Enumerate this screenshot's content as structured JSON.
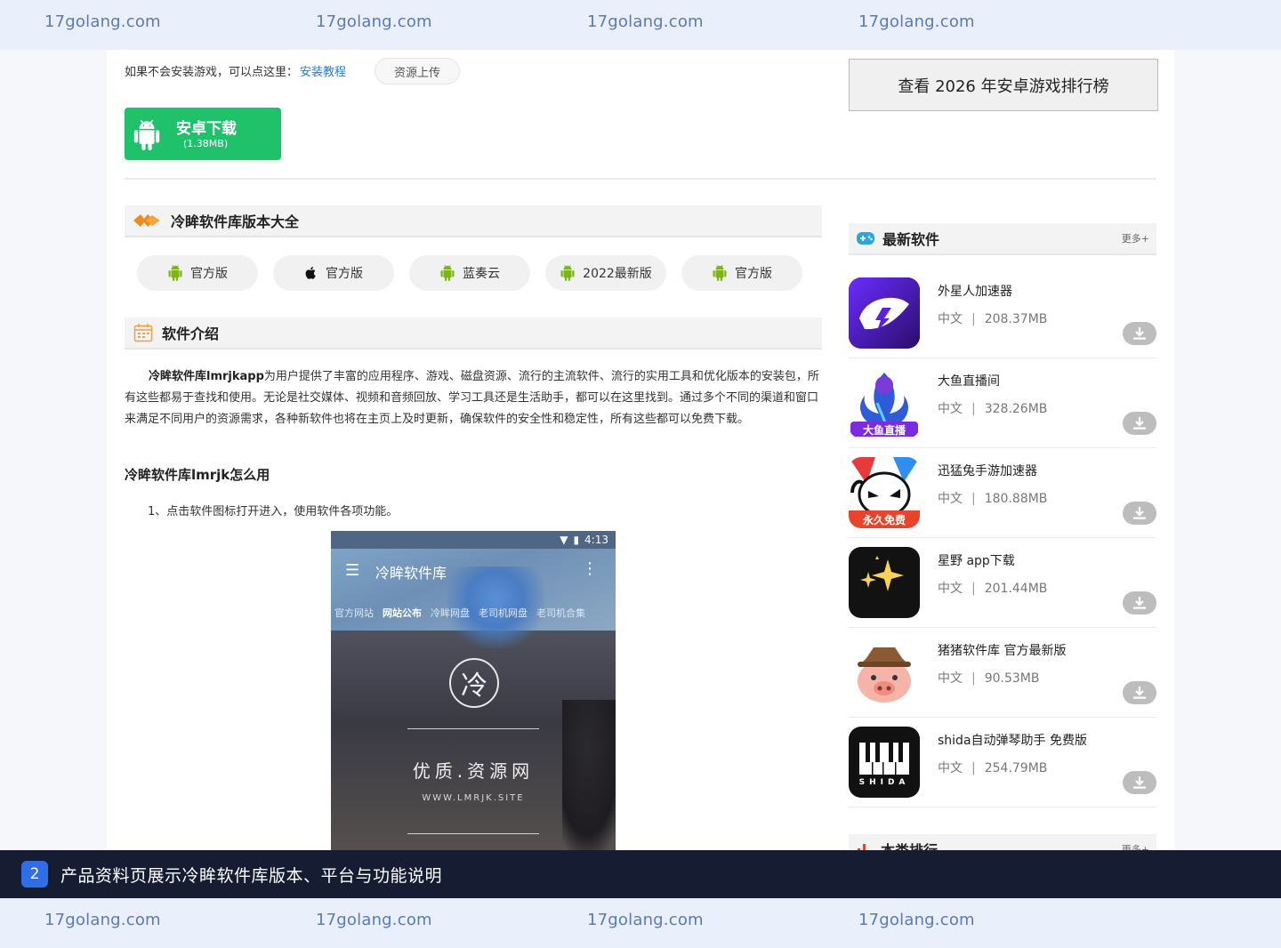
{
  "watermarks": [
    "17golang.com",
    "17golang.com",
    "17golang.com",
    "17golang.com"
  ],
  "install": {
    "hint": "如果不会安装游戏，可以点这里：",
    "link": "安装教程",
    "upload": "资源上传"
  },
  "download": {
    "label": "安卓下载",
    "size": "(1.38MB)"
  },
  "ranking_button": "查看 2026 年安卓游戏排行榜",
  "versions": {
    "title": "冷眸软件库版本大全",
    "items": [
      {
        "label": "官方版",
        "icon": "android-icon"
      },
      {
        "label": "官方版",
        "icon": "apple-icon"
      },
      {
        "label": "蓝奏云",
        "icon": "android-icon"
      },
      {
        "label": "2022最新版",
        "icon": "android-icon"
      },
      {
        "label": "官方版",
        "icon": "android-icon"
      }
    ]
  },
  "intro": {
    "title": "软件介绍",
    "bold": "冷眸软件库lmrjkapp",
    "body": "为用户提供了丰富的应用程序、游戏、磁盘资源、流行的主流软件、流行的实用工具和优化版本的安装包，所有这些都易于查找和使用。无论是社交媒体、视频和音频回放、学习工具还是生活助手，都可以在这里找到。通过多个不同的渠道和窗口来满足不同用户的资源需求，各种新软件也将在主页上及时更新，确保软件的安全性和稳定性，所有这些都可以免费下载。",
    "howto_title": "冷眸软件库lmrjk怎么用",
    "step1": "1、点击软件图标打开进入，使用软件各项功能。"
  },
  "screenshot": {
    "time": "4:13",
    "app_name": "冷眸软件库",
    "tabs": [
      "官方网站",
      "网站公布",
      "冷眸网盘",
      "老司机网盘",
      "老司机合集"
    ],
    "seal_char": "冷",
    "slogan": "优质.资源网",
    "site": "WWW.LMRJK.SITE"
  },
  "latest": {
    "title": "最新软件",
    "more": "更多+",
    "items": [
      {
        "name": "外星人加速器",
        "lang": "中文",
        "size": "208.37MB"
      },
      {
        "name": "大鱼直播间",
        "lang": "中文",
        "size": "328.26MB",
        "icon_text": "大鱼直播"
      },
      {
        "name": "迅猛兔手游加速器",
        "lang": "中文",
        "size": "180.88MB",
        "icon_text": "永久免费"
      },
      {
        "name": "星野 app下载",
        "lang": "中文",
        "size": "201.44MB"
      },
      {
        "name": "猪猪软件库 官方最新版",
        "lang": "中文",
        "size": "90.53MB"
      },
      {
        "name": "shida自动弹琴助手 免费版",
        "lang": "中文",
        "size": "254.79MB",
        "icon_text": "SHIDA"
      }
    ]
  },
  "category_rank": {
    "title": "本类排行",
    "more": "更多+"
  },
  "caption": {
    "number": "2",
    "text": "产品资料页展示冷眸软件库版本、平台与功能说明"
  },
  "colors": {
    "download_green": "#1fc16b",
    "link_blue": "#1f7ae0",
    "android_green": "#7cb518",
    "caption_bg": "#161d33",
    "badge_blue": "#2f6ee6"
  }
}
